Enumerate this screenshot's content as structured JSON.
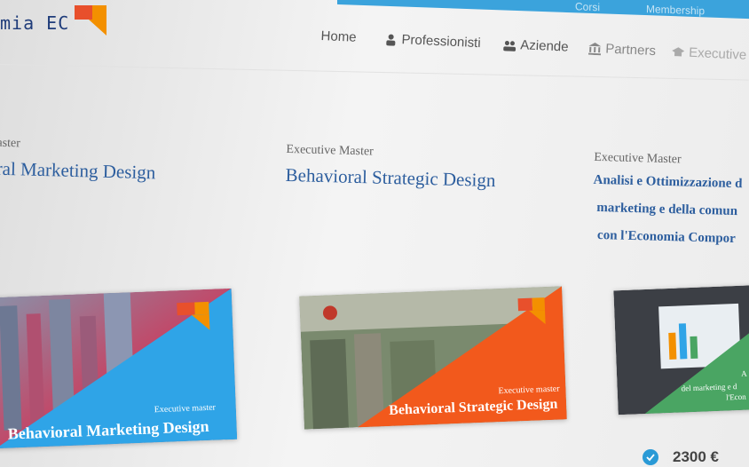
{
  "header": {
    "logo_text": "mia EC",
    "top_links": [
      "Corsi",
      "Membership"
    ]
  },
  "nav": {
    "items": [
      {
        "label": "Home",
        "icon": "none"
      },
      {
        "label": "Professionisti",
        "icon": "user-icon"
      },
      {
        "label": "Aziende",
        "icon": "users-icon"
      },
      {
        "label": "Partners",
        "icon": "bank-icon"
      },
      {
        "label": "Executive M",
        "icon": "cap-icon"
      }
    ]
  },
  "courses": [
    {
      "subtitle": "aster",
      "title": "ral Marketing Design",
      "card_small": "Executive master",
      "card_big": "Behavioral Marketing Design",
      "color": "#2fa4e7"
    },
    {
      "subtitle": "Executive Master",
      "title": "Behavioral Strategic Design",
      "card_small": "Executive master",
      "card_big": "Behavioral Strategic Design",
      "color": "#f2591c"
    },
    {
      "subtitle": "Executive Master",
      "title_lines": [
        "Analisi e Ottimizzazione d",
        "marketing e della comun",
        "con l'Economia Compor"
      ],
      "card_lines": [
        "A",
        "del marketing e d",
        "l'Econ"
      ],
      "color": "#4aa563"
    }
  ],
  "price": "2300 €",
  "colors": {
    "brand_orange": "#f39000",
    "brand_red": "#e8502c",
    "title_blue": "#2d5e9e"
  }
}
